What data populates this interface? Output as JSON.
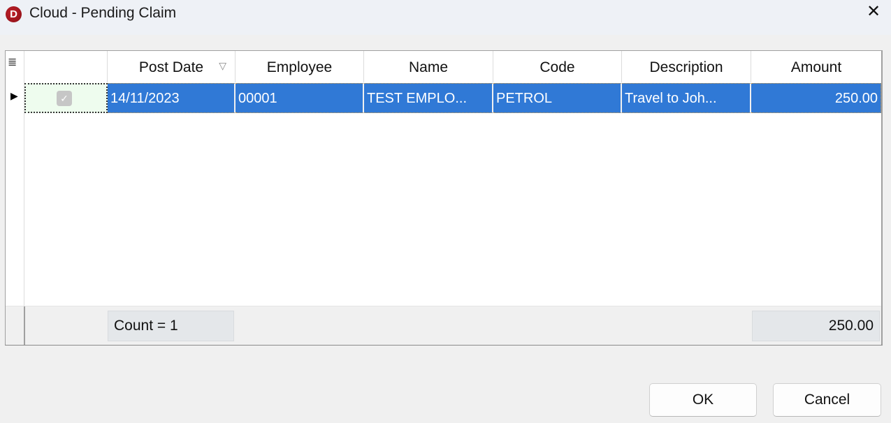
{
  "window": {
    "title": "Cloud - Pending Claim",
    "app_icon_letter": "D",
    "close_glyph": "✕"
  },
  "grid": {
    "columns": [
      {
        "key": "select",
        "label": ""
      },
      {
        "key": "post_date",
        "label": "Post Date",
        "filter_icon": "▽"
      },
      {
        "key": "employee",
        "label": "Employee"
      },
      {
        "key": "name",
        "label": "Name"
      },
      {
        "key": "code",
        "label": "Code"
      },
      {
        "key": "description",
        "label": "Description"
      },
      {
        "key": "amount",
        "label": "Amount"
      }
    ],
    "column_chooser_glyph": "≣",
    "row_indicator_glyph": "▶",
    "rows": [
      {
        "selected": true,
        "checked": true,
        "post_date": "14/11/2023",
        "employee": "00001",
        "name": "TEST EMPLO...",
        "code": "PETROL",
        "description": "Travel to Joh...",
        "amount": "250.00"
      }
    ],
    "footer": {
      "count": "Count = 1",
      "amount_total": "250.00"
    }
  },
  "buttons": {
    "ok": "OK",
    "cancel": "Cancel"
  },
  "colors": {
    "selection": "#3079d6",
    "checkbox_cell": "#eefcee"
  }
}
